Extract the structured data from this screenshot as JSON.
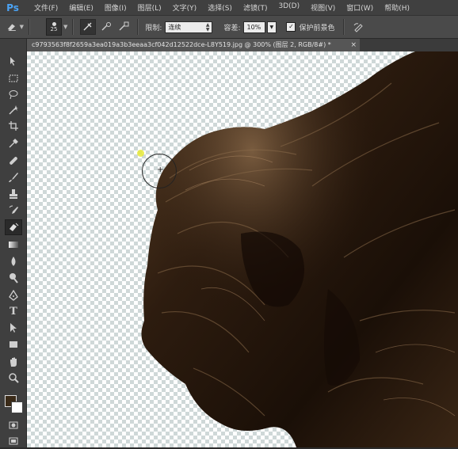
{
  "app": {
    "logo": "Ps"
  },
  "menu": [
    "文件(F)",
    "编辑(E)",
    "图像(I)",
    "图层(L)",
    "文字(Y)",
    "选择(S)",
    "滤镜(T)",
    "3D(D)",
    "视图(V)",
    "窗口(W)",
    "帮助(H)"
  ],
  "options": {
    "brush_size": "25",
    "limit_label": "限制:",
    "limit_value": "连续",
    "tolerance_label": "容差:",
    "tolerance_value": "10%",
    "protect_label": "保护前景色",
    "protect_checked": "✓"
  },
  "document": {
    "tab_title": "c9793563f8f2659a3ea019a3b3eeaa3cf042d12522dce-L8Y519.jpg @ 300% (图层 2, RGB/8#) *",
    "close": "×"
  },
  "toolbar": {
    "type_tool_glyph": "T"
  },
  "colors": {
    "accent": "#4ba3f5",
    "foreground": "#3a2a18",
    "background": "#ffffff",
    "cursor_hotspot": "#e8ea38"
  },
  "icons": [
    "photoshop-logo",
    "background-eraser-icon",
    "brush-preset-icon",
    "sampling-continuous-icon",
    "sampling-once-icon",
    "sampling-swatch-icon",
    "pressure-icon"
  ]
}
